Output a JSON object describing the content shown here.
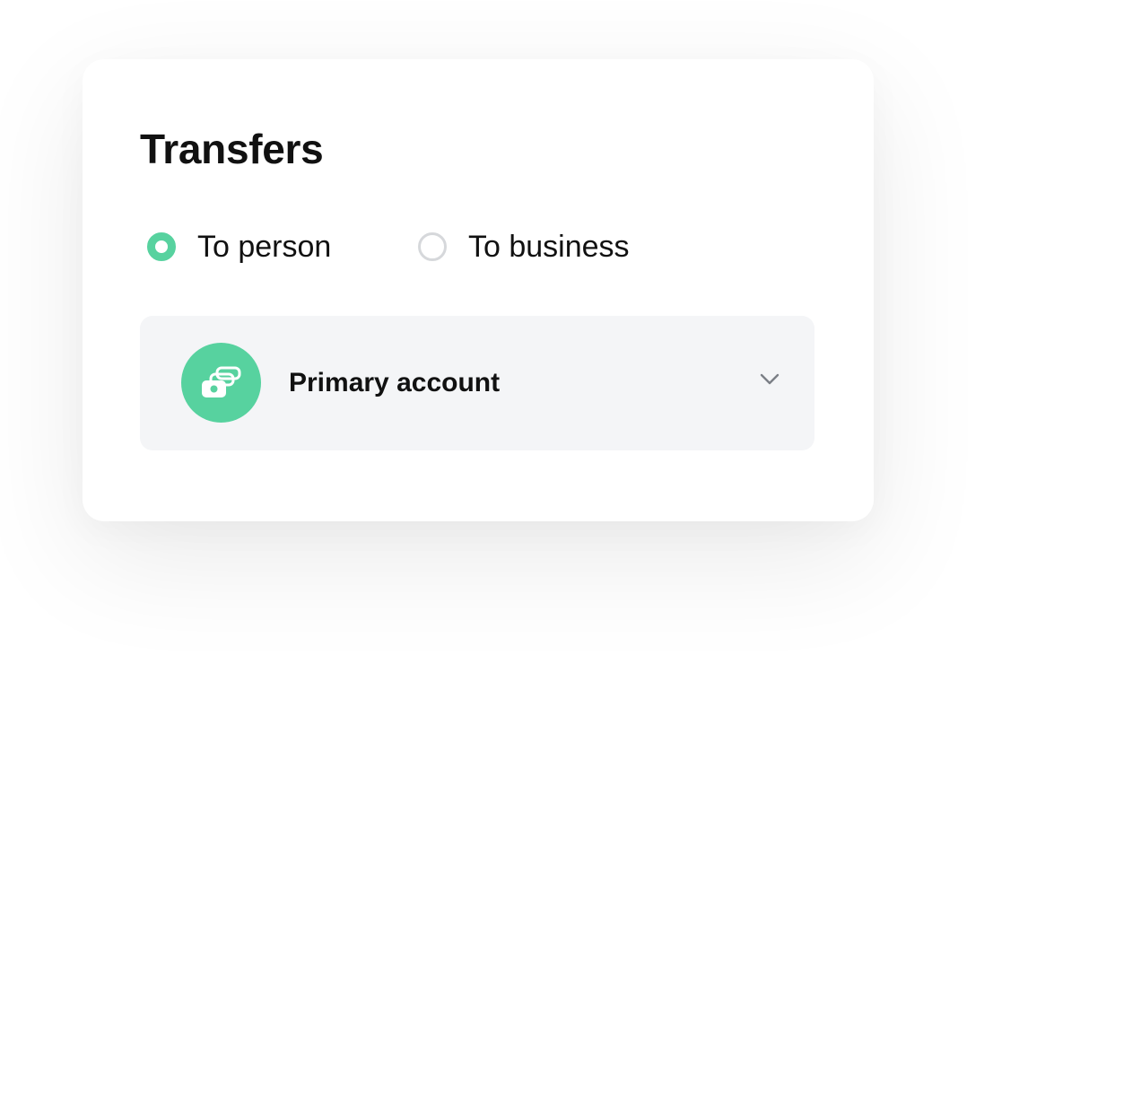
{
  "transfers": {
    "title": "Transfers",
    "options": [
      {
        "label": "To person",
        "selected": true
      },
      {
        "label": "To business",
        "selected": false
      }
    ],
    "account": {
      "label": "Primary account",
      "icon": "money-stack-icon",
      "dropdown_icon": "chevron-down-icon"
    }
  },
  "colors": {
    "accent": "#57d29f",
    "select_background": "#f4f5f7",
    "text": "#111111",
    "radio_unchecked_border": "#d6d8db"
  }
}
